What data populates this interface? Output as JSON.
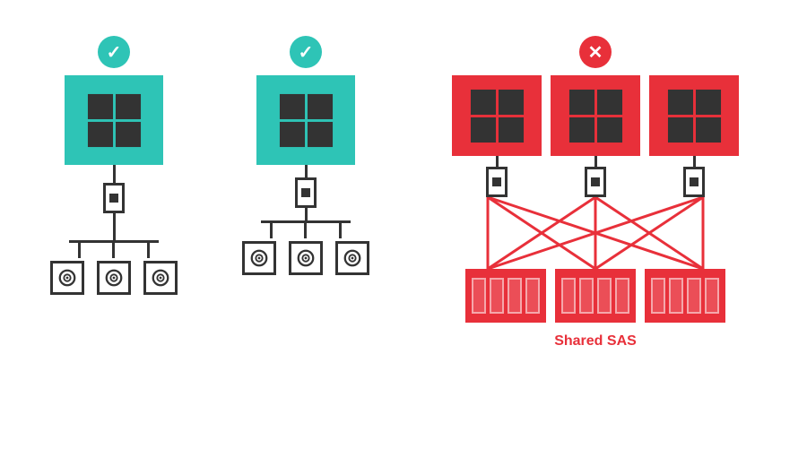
{
  "diagrams": {
    "col1": {
      "status": "check",
      "status_label": "valid",
      "server_color": "teal",
      "drives_count": 3,
      "label": ""
    },
    "col2": {
      "status": "check",
      "status_label": "valid",
      "server_color": "teal",
      "drives_count": 3,
      "label": ""
    },
    "col3": {
      "status": "cross",
      "status_label": "invalid",
      "servers_count": 3,
      "storage_count": 3,
      "label": "Shared SAS"
    }
  },
  "icons": {
    "check_symbol": "✓",
    "cross_symbol": "✕"
  }
}
